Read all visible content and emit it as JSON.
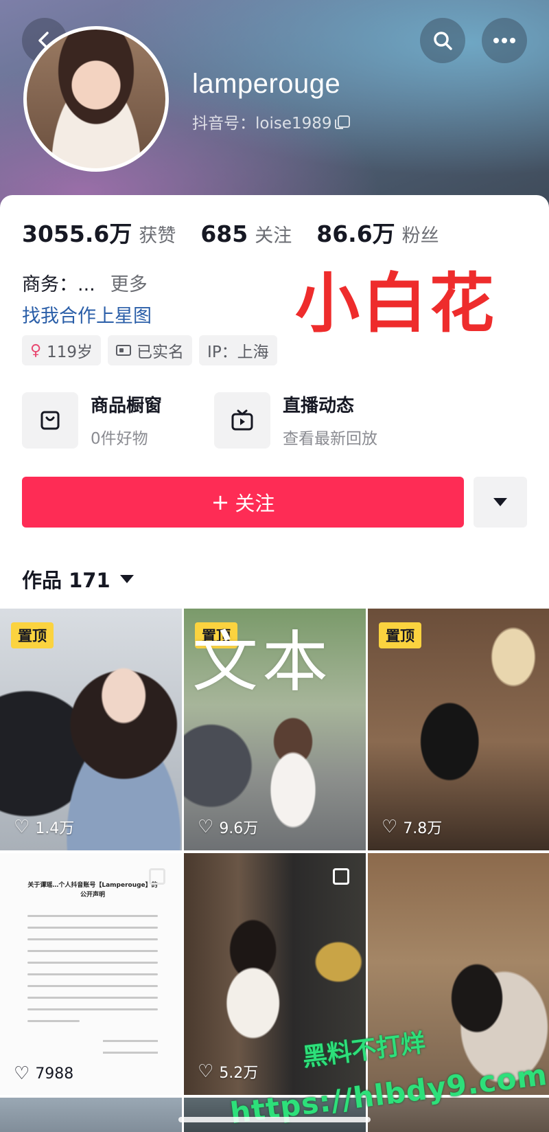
{
  "header": {
    "username": "lamperouge",
    "douyin_id": "抖音号：loise1989"
  },
  "stats": {
    "likes_num": "3055.6万",
    "likes_label": "获赞",
    "following_num": "685",
    "following_label": "关注",
    "fans_num": "86.6万",
    "fans_label": "粉丝"
  },
  "bio": {
    "business": "商务：...",
    "more": "更多",
    "star_link": "找我合作上星图",
    "overlay_text": "小白花"
  },
  "tags": {
    "age": "119岁",
    "verified": "已实名",
    "ip": "IP：上海"
  },
  "shortcuts": {
    "shop_title": "商品橱窗",
    "shop_sub": "0件好物",
    "live_title": "直播动态",
    "live_sub": "查看最新回放"
  },
  "follow": {
    "label": "关注",
    "plus": "+"
  },
  "works": {
    "label": "作品 171"
  },
  "grid": {
    "pin_label": "置顶",
    "text_overlay": "文本",
    "tiles": [
      {
        "likes": "1.4万"
      },
      {
        "likes": "9.6万"
      },
      {
        "likes": "7.8万"
      },
      {
        "likes": "7988"
      },
      {
        "likes": "5.2万"
      }
    ],
    "doc_title": "关于谭瑶…个人抖音账号【Lamperouge】的公开声明"
  },
  "watermark": {
    "line1": "黑料不打烊",
    "line2": "https://hlbdy9.com"
  },
  "colors": {
    "accent": "#fe2c55",
    "pin": "#fbd33f",
    "link": "#2a5ea8",
    "overlay_red": "#ee2c2c"
  }
}
